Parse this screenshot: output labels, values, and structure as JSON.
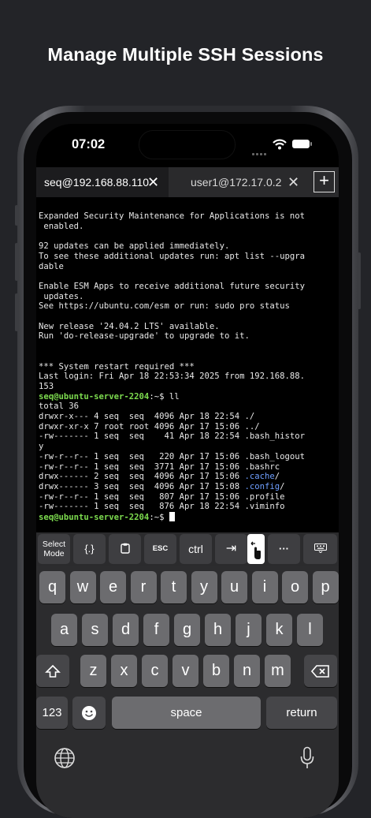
{
  "headline": "Manage Multiple SSH Sessions",
  "status_bar": {
    "time": "07:02",
    "icons": [
      "signal-icon",
      "wifi-icon",
      "battery-icon"
    ]
  },
  "tabs": [
    {
      "label": "seq@192.168.88.110",
      "close": "✕",
      "active": true
    },
    {
      "label": "user1@172.17.0.2",
      "close": "✕",
      "active": false
    }
  ],
  "new_tab_label": "+",
  "terminal": {
    "motd": [
      "Expanded Security Maintenance for Applications is not",
      " enabled.",
      "",
      "92 updates can be applied immediately.",
      "To see these additional updates run: apt list --upgra",
      "dable",
      "",
      "Enable ESM Apps to receive additional future security",
      " updates.",
      "See https://ubuntu.com/esm or run: sudo pro status",
      "",
      "New release '24.04.2 LTS' available.",
      "Run 'do-release-upgrade' to upgrade to it.",
      "",
      "",
      "*** System restart required ***",
      "Last login: Fri Apr 18 22:53:34 2025 from 192.168.88.",
      "153"
    ],
    "prompt": "seq@ubuntu-server-2204",
    "prompt_suffix": ":~$ ",
    "command": "ll",
    "total": "total 36",
    "listing": [
      {
        "meta": "drwxr-x--- 4 seq  seq  4096 Apr 18 22:54 ",
        "name": "./",
        "dir": false
      },
      {
        "meta": "drwxr-xr-x 7 root root 4096 Apr 17 15:06 ",
        "name": "../",
        "dir": false
      },
      {
        "meta": "-rw------- 1 seq  seq    41 Apr 18 22:54 ",
        "name": ".bash_histor\ny",
        "dir": false
      },
      {
        "meta": "-rw-r--r-- 1 seq  seq   220 Apr 17 15:06 ",
        "name": ".bash_logout",
        "dir": false
      },
      {
        "meta": "-rw-r--r-- 1 seq  seq  3771 Apr 17 15:06 ",
        "name": ".bashrc",
        "dir": false
      },
      {
        "meta": "drwx------ 2 seq  seq  4096 Apr 17 15:06 ",
        "name": ".cache",
        "dir": true
      },
      {
        "meta": "drwx------ 3 seq  seq  4096 Apr 17 15:08 ",
        "name": ".config",
        "dir": true
      },
      {
        "meta": "-rw-r--r-- 1 seq  seq   807 Apr 17 15:06 ",
        "name": ".profile",
        "dir": false
      },
      {
        "meta": "-rw------- 1 seq  seq   876 Apr 18 22:54 ",
        "name": ".viminfo",
        "dir": false
      }
    ]
  },
  "toolbar": {
    "select_mode": "Select\nMode",
    "braces": "{.}",
    "esc": "ESC",
    "ctrl": "ctrl",
    "more": "···"
  },
  "keyboard": {
    "row1": [
      "q",
      "w",
      "e",
      "r",
      "t",
      "y",
      "u",
      "i",
      "o",
      "p"
    ],
    "row2": [
      "a",
      "s",
      "d",
      "f",
      "g",
      "h",
      "j",
      "k",
      "l"
    ],
    "row3": [
      "z",
      "x",
      "c",
      "v",
      "b",
      "n",
      "m"
    ],
    "numbers": "123",
    "space": "space",
    "return": "return"
  }
}
